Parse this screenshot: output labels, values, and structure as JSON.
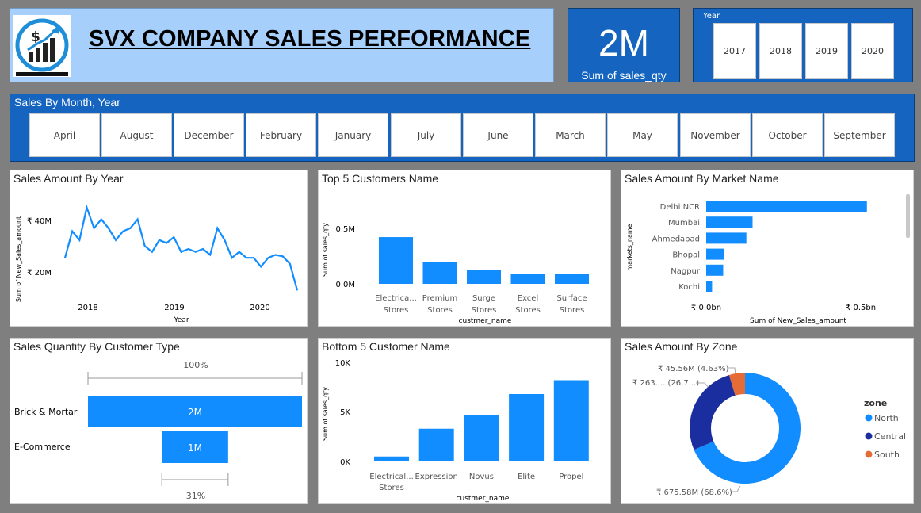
{
  "header": {
    "title": "SVX COMPANY SALES PERFORMANCE"
  },
  "kpi": {
    "value": "2M",
    "label": "Sum of sales_qty"
  },
  "year_slicer": {
    "title": "Year",
    "options": [
      "2017",
      "2018",
      "2019",
      "2020"
    ]
  },
  "month_slicer": {
    "title": "Sales By Month, Year",
    "options": [
      "April",
      "August",
      "December",
      "February",
      "January",
      "July",
      "June",
      "March",
      "May",
      "November",
      "October",
      "September"
    ]
  },
  "colors": {
    "accent": "#1565c0",
    "bar": "#118dff",
    "central": "#1a2ea0",
    "south": "#e66c37"
  },
  "panels": {
    "sales_by_year": {
      "title": "Sales Amount By Year",
      "ylabel": "Sum of New_Sales_amount",
      "xlabel": "Year",
      "yticks": [
        "₹ 40M",
        "₹ 20M"
      ],
      "xticks": [
        "2018",
        "2019",
        "2020"
      ]
    },
    "top5": {
      "title": "Top 5 Customers Name",
      "ylabel": "Sum of sales_qty",
      "xlabel": "custmer_name",
      "yticks": [
        "0.5M",
        "0.0M"
      ],
      "cats": [
        [
          "Electrica...",
          "Stores"
        ],
        [
          "Premium",
          "Stores"
        ],
        [
          "Surge",
          "Stores"
        ],
        [
          "Excel",
          "Stores"
        ],
        [
          "Surface",
          "Stores"
        ]
      ]
    },
    "market": {
      "title": "Sales Amount By Market Name",
      "ylabel": "markets_name",
      "xlabel": "Sum of New_Sales_amount",
      "cats": [
        "Delhi NCR",
        "Mumbai",
        "Ahmedabad",
        "Bhopal",
        "Nagpur",
        "Kochi"
      ],
      "xticks": [
        "₹ 0.0bn",
        "₹ 0.5bn"
      ]
    },
    "cust_type": {
      "title": "Sales Quantity By Customer Type",
      "top_pct": "100%",
      "bottom_pct": "31%",
      "cats": [
        "Brick & Mortar",
        "E-Commerce"
      ],
      "labels": [
        "2M",
        "1M"
      ]
    },
    "bottom5": {
      "title": "Bottom 5 Customer Name",
      "ylabel": "Sum of sales_qty",
      "xlabel": "custmer_name",
      "yticks": [
        "10K",
        "5K",
        "0K"
      ],
      "cats": [
        [
          "Electrical...",
          "Stores"
        ],
        [
          "Expression"
        ],
        [
          "Novus"
        ],
        [
          "Elite"
        ],
        [
          "Propel"
        ]
      ]
    },
    "zone": {
      "title": "Sales Amount By Zone",
      "legend_title": "zone",
      "legend": [
        "North",
        "Central",
        "South"
      ],
      "labels": [
        "₹ 45.56M (4.63%)",
        "₹ 263.... (26.7...)",
        "₹ 675.58M (68.6%)"
      ]
    }
  },
  "chart_data": [
    {
      "type": "line",
      "title": "Sales Amount By Year",
      "xlabel": "Year",
      "ylabel": "Sum of New_Sales_amount",
      "x": [
        "2017-10",
        "2017-11",
        "2017-12",
        "2018-01",
        "2018-02",
        "2018-03",
        "2018-04",
        "2018-05",
        "2018-06",
        "2018-07",
        "2018-08",
        "2018-09",
        "2018-10",
        "2018-11",
        "2018-12",
        "2019-01",
        "2019-02",
        "2019-03",
        "2019-04",
        "2019-05",
        "2019-06",
        "2019-07",
        "2019-08",
        "2019-09",
        "2019-10",
        "2019-11",
        "2019-12",
        "2020-01",
        "2020-02",
        "2020-03",
        "2020-04",
        "2020-05",
        "2020-06"
      ],
      "values": [
        26,
        35,
        32,
        43,
        36,
        39,
        36,
        32,
        35,
        36,
        39,
        30,
        28,
        32,
        31,
        33,
        28,
        29,
        28,
        29,
        27,
        36,
        32,
        26,
        28,
        26,
        26,
        23,
        26,
        27,
        26.5,
        24,
        15
      ],
      "ylim": [
        10,
        48
      ]
    },
    {
      "type": "bar",
      "title": "Top 5 Customers Name",
      "xlabel": "custmer_name",
      "ylabel": "Sum of sales_qty",
      "categories": [
        "Electricalsara Stores",
        "Premium Stores",
        "Surge Stores",
        "Excel Stores",
        "Surface Stores"
      ],
      "values": [
        0.41,
        0.19,
        0.12,
        0.09,
        0.085
      ],
      "ylim": [
        0,
        0.8
      ]
    },
    {
      "type": "bar",
      "title": "Sales Amount By Market Name",
      "orientation": "horizontal",
      "xlabel": "Sum of New_Sales_amount",
      "ylabel": "markets_name",
      "categories": [
        "Delhi NCR",
        "Mumbai",
        "Ahmedabad",
        "Bhopal",
        "Nagpur",
        "Kochi"
      ],
      "values": [
        0.52,
        0.15,
        0.13,
        0.058,
        0.055,
        0.019
      ],
      "xlim": [
        0,
        0.56
      ]
    },
    {
      "type": "bar",
      "title": "Sales Quantity By Customer Type",
      "categories": [
        "Brick & Mortar",
        "E-Commerce"
      ],
      "values": [
        2.0,
        0.62
      ]
    },
    {
      "type": "bar",
      "title": "Bottom 5 Customer Name",
      "xlabel": "custmer_name",
      "ylabel": "Sum of sales_qty",
      "categories": [
        "Electricalsbea Stores",
        "Expression",
        "Novus",
        "Elite",
        "Propel"
      ],
      "values": [
        500,
        3300,
        4700,
        6800,
        8200
      ],
      "ylim": [
        0,
        10000
      ]
    },
    {
      "type": "pie",
      "title": "Sales Amount By Zone",
      "categories": [
        "North",
        "Central",
        "South"
      ],
      "values": [
        68.6,
        26.7,
        4.63
      ]
    }
  ]
}
